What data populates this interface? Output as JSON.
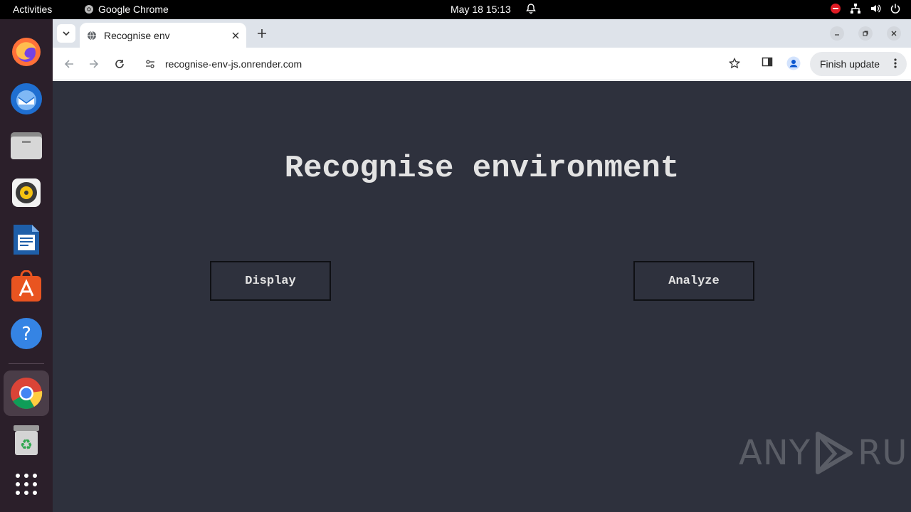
{
  "topbar": {
    "activities": "Activities",
    "app_name": "Google Chrome",
    "datetime": "May 18  15:13"
  },
  "dock": {
    "items": [
      {
        "name": "firefox-icon"
      },
      {
        "name": "thunderbird-icon"
      },
      {
        "name": "files-icon"
      },
      {
        "name": "rhythmbox-icon"
      },
      {
        "name": "libreoffice-writer-icon"
      },
      {
        "name": "app-center-icon"
      },
      {
        "name": "help-icon"
      },
      {
        "name": "chrome-icon"
      },
      {
        "name": "trash-icon"
      },
      {
        "name": "show-apps-icon"
      }
    ]
  },
  "browser": {
    "tab_title": "Recognise env",
    "url": "recognise-env-js.onrender.com",
    "finish_update": "Finish update"
  },
  "page": {
    "heading": "Recognise environment",
    "buttons": {
      "display": "Display",
      "analyze": "Analyze"
    },
    "watermark_left": "ANY",
    "watermark_right": "RUN"
  },
  "colors": {
    "page_bg": "#2e313d",
    "text": "#e3e3e3",
    "dock_bg": "#2b1f2a",
    "accent": "#e95420"
  }
}
